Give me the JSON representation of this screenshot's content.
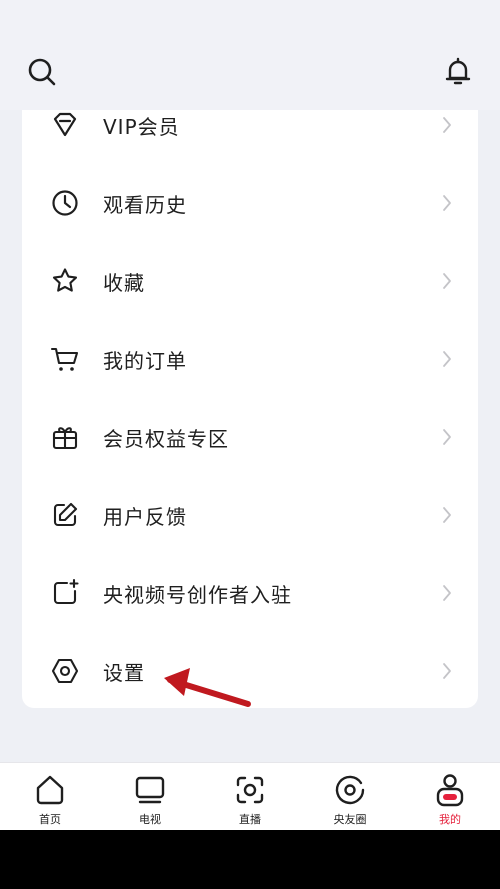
{
  "menu": {
    "items": [
      {
        "label": "VIP会员",
        "icon": "diamond-icon"
      },
      {
        "label": "观看历史",
        "icon": "clock-icon"
      },
      {
        "label": "收藏",
        "icon": "star-icon"
      },
      {
        "label": "我的订单",
        "icon": "cart-icon"
      },
      {
        "label": "会员权益专区",
        "icon": "gift-icon"
      },
      {
        "label": "用户反馈",
        "icon": "edit-icon"
      },
      {
        "label": "央视频号创作者入驻",
        "icon": "creator-icon"
      },
      {
        "label": "设置",
        "icon": "settings-icon"
      }
    ]
  },
  "tabbar": {
    "tabs": [
      {
        "label": "首页",
        "icon": "home-icon"
      },
      {
        "label": "电视",
        "icon": "tv-icon"
      },
      {
        "label": "直播",
        "icon": "live-icon"
      },
      {
        "label": "央友圈",
        "icon": "circle-icon"
      },
      {
        "label": "我的",
        "icon": "profile-icon",
        "active": true
      }
    ]
  },
  "colors": {
    "accent": "#e5213c",
    "annotation_arrow": "#c0191f"
  }
}
